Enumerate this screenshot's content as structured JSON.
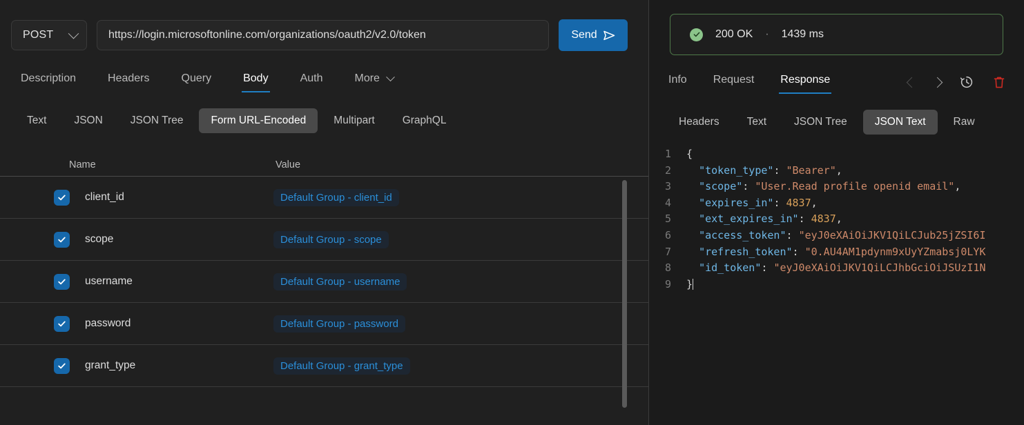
{
  "request": {
    "method": "POST",
    "url": "https://login.microsoftonline.com/organizations/oauth2/v2.0/token",
    "send_label": "Send",
    "tabs": [
      {
        "label": "Description",
        "active": false
      },
      {
        "label": "Headers",
        "active": false
      },
      {
        "label": "Query",
        "active": false
      },
      {
        "label": "Body",
        "active": true
      },
      {
        "label": "Auth",
        "active": false
      },
      {
        "label": "More",
        "active": false
      }
    ],
    "body_types": [
      {
        "label": "Text",
        "active": false
      },
      {
        "label": "JSON",
        "active": false
      },
      {
        "label": "JSON Tree",
        "active": false
      },
      {
        "label": "Form URL-Encoded",
        "active": true
      },
      {
        "label": "Multipart",
        "active": false
      },
      {
        "label": "GraphQL",
        "active": false
      }
    ],
    "table": {
      "headers": {
        "name": "Name",
        "value": "Value"
      },
      "rows": [
        {
          "enabled": true,
          "name": "client_id",
          "value": "Default Group - client_id"
        },
        {
          "enabled": true,
          "name": "scope",
          "value": "Default Group - scope"
        },
        {
          "enabled": true,
          "name": "username",
          "value": "Default Group - username"
        },
        {
          "enabled": true,
          "name": "password",
          "value": "Default Group - password"
        },
        {
          "enabled": true,
          "name": "grant_type",
          "value": "Default Group - grant_type"
        }
      ]
    }
  },
  "response": {
    "status": {
      "icon": "check-circle-icon",
      "code": "200 OK",
      "separator": "·",
      "time": "1439 ms"
    },
    "tabs": [
      {
        "label": "Info",
        "active": false
      },
      {
        "label": "Request",
        "active": false
      },
      {
        "label": "Response",
        "active": true
      }
    ],
    "actions": [
      {
        "name": "prev-response-button",
        "icon": "chevron-left-icon"
      },
      {
        "name": "next-response-button",
        "icon": "chevron-right-icon"
      },
      {
        "name": "history-button",
        "icon": "history-clock-icon"
      },
      {
        "name": "delete-response-button",
        "icon": "trash-icon"
      }
    ],
    "view_tabs": [
      {
        "label": "Headers",
        "active": false
      },
      {
        "label": "Text",
        "active": false
      },
      {
        "label": "JSON Tree",
        "active": false
      },
      {
        "label": "JSON Text",
        "active": true
      },
      {
        "label": "Raw",
        "active": false
      }
    ],
    "code": {
      "lines": [
        {
          "no": "1",
          "tokens": [
            {
              "t": "p",
              "v": "{"
            }
          ]
        },
        {
          "no": "2",
          "tokens": [
            {
              "t": "p",
              "v": "  "
            },
            {
              "t": "k",
              "v": "\"token_type\""
            },
            {
              "t": "p",
              "v": ": "
            },
            {
              "t": "s",
              "v": "\"Bearer\""
            },
            {
              "t": "p",
              "v": ","
            }
          ]
        },
        {
          "no": "3",
          "tokens": [
            {
              "t": "p",
              "v": "  "
            },
            {
              "t": "k",
              "v": "\"scope\""
            },
            {
              "t": "p",
              "v": ": "
            },
            {
              "t": "s",
              "v": "\"User.Read profile openid email\""
            },
            {
              "t": "p",
              "v": ","
            }
          ]
        },
        {
          "no": "4",
          "tokens": [
            {
              "t": "p",
              "v": "  "
            },
            {
              "t": "k",
              "v": "\"expires_in\""
            },
            {
              "t": "p",
              "v": ": "
            },
            {
              "t": "n",
              "v": "4837"
            },
            {
              "t": "p",
              "v": ","
            }
          ]
        },
        {
          "no": "5",
          "tokens": [
            {
              "t": "p",
              "v": "  "
            },
            {
              "t": "k",
              "v": "\"ext_expires_in\""
            },
            {
              "t": "p",
              "v": ": "
            },
            {
              "t": "n",
              "v": "4837"
            },
            {
              "t": "p",
              "v": ","
            }
          ]
        },
        {
          "no": "6",
          "tokens": [
            {
              "t": "p",
              "v": "  "
            },
            {
              "t": "k",
              "v": "\"access_token\""
            },
            {
              "t": "p",
              "v": ": "
            },
            {
              "t": "s",
              "v": "\"eyJ0eXAiOiJKV1QiLCJub25jZSI6I"
            }
          ]
        },
        {
          "no": "7",
          "tokens": [
            {
              "t": "p",
              "v": "  "
            },
            {
              "t": "k",
              "v": "\"refresh_token\""
            },
            {
              "t": "p",
              "v": ": "
            },
            {
              "t": "s",
              "v": "\"0.AU4AM1pdynm9xUyYZmabsj0LYK"
            }
          ]
        },
        {
          "no": "8",
          "tokens": [
            {
              "t": "p",
              "v": "  "
            },
            {
              "t": "k",
              "v": "\"id_token\""
            },
            {
              "t": "p",
              "v": ": "
            },
            {
              "t": "s",
              "v": "\"eyJ0eXAiOiJKV1QiLCJhbGciOiJSUzI1N"
            }
          ]
        },
        {
          "no": "9",
          "tokens": [
            {
              "t": "p",
              "v": "}"
            }
          ]
        }
      ]
    }
  },
  "colors": {
    "accent_blue": "#1668ab",
    "tab_underline": "#1f7fc4",
    "success_green": "#8bc48a",
    "success_border": "#4f7a4a",
    "danger_red": "#cc2a22",
    "chip_bg": "#1d2631",
    "chip_text": "#2b8fd9",
    "json_key": "#6fb7e6",
    "json_string": "#cf8a6a",
    "json_number": "#d8a05a"
  }
}
